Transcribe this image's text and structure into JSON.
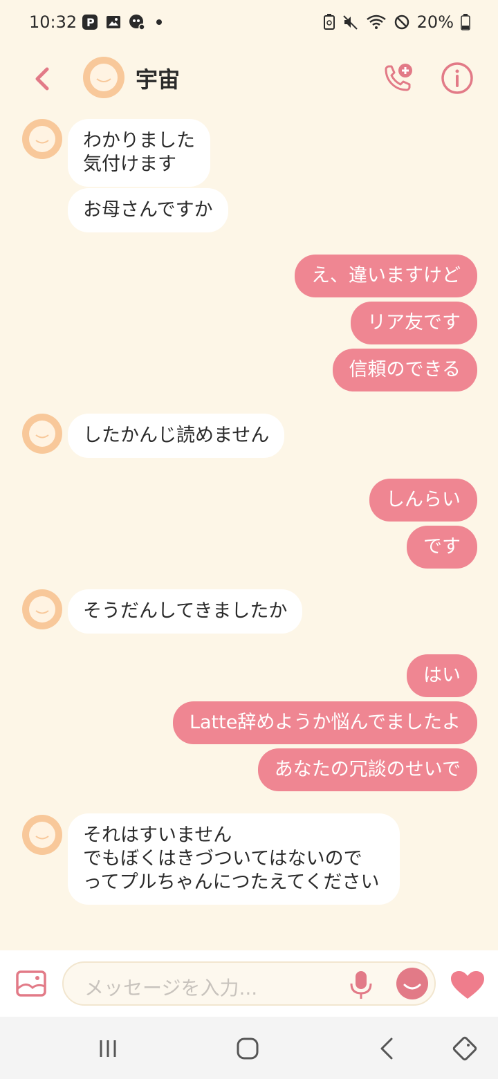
{
  "status": {
    "time": "10:32",
    "battery": "20%"
  },
  "header": {
    "name": "宇宙"
  },
  "messages": [
    {
      "side": "in",
      "text": "わかりました\n気付けます"
    },
    {
      "side": "in",
      "text": "お母さんですか"
    },
    {
      "side": "out",
      "text": "え、違いますけど"
    },
    {
      "side": "out",
      "text": "リア友です"
    },
    {
      "side": "out",
      "text": "信頼のできる"
    },
    {
      "side": "in",
      "text": "したかんじ読めません"
    },
    {
      "side": "out",
      "text": "しんらい"
    },
    {
      "side": "out",
      "text": "です"
    },
    {
      "side": "in",
      "text": "そうだんしてきましたか"
    },
    {
      "side": "out",
      "text": "はい"
    },
    {
      "side": "out",
      "text": "Latte辞めようか悩んでましたよ"
    },
    {
      "side": "out",
      "text": "あなたの冗談のせいで"
    },
    {
      "side": "in",
      "text": "それはすいません\nでもぼくはきづついてはないので\nってプルちゃんにつたえてください"
    }
  ],
  "input": {
    "placeholder": "メッセージを入力..."
  },
  "colors": {
    "accent": "#ef8692",
    "background": "#fdf6e7",
    "avatar": "#f8c89a"
  },
  "icons": [
    "back-icon",
    "call-add-icon",
    "info-icon",
    "gallery-icon",
    "mic-icon",
    "emoji-icon",
    "heart-icon",
    "recent-apps-icon",
    "home-icon",
    "nav-back-icon",
    "rotate-icon"
  ]
}
